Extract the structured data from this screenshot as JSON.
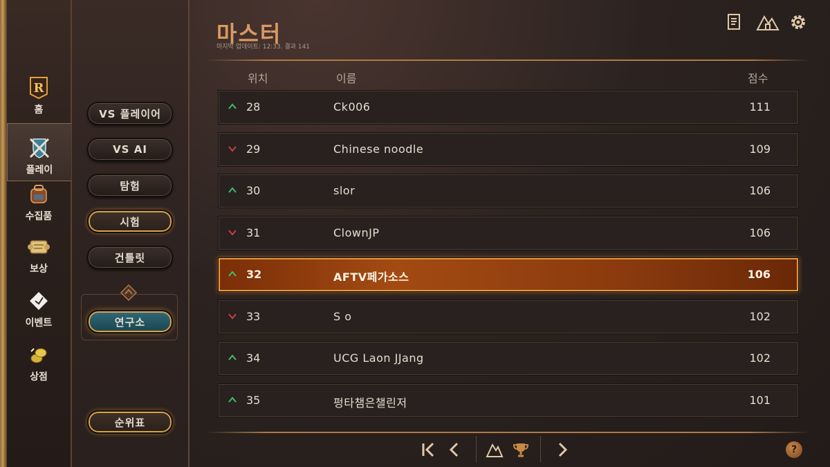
{
  "nav": {
    "items": [
      {
        "label": "홈",
        "icon": "logo-r-icon"
      },
      {
        "label": "플레이",
        "icon": "crossed-swords-shield-icon"
      },
      {
        "label": "수집품",
        "icon": "backpack-icon"
      },
      {
        "label": "보상",
        "icon": "scroll-icon"
      },
      {
        "label": "이벤트",
        "icon": "diamond-event-icon"
      },
      {
        "label": "상점",
        "icon": "coins-icon"
      }
    ]
  },
  "modes": {
    "vs_player": "VS 플레이어",
    "vs_ai": "VS AI",
    "expedition": "탐험",
    "trial": "시험",
    "gauntlet": "건틀릿",
    "lab": "연구소",
    "ladder": "순위표"
  },
  "header": {
    "title": "마스터",
    "subtitle": "마지막 업데이트: 12:33. 결과 141"
  },
  "columns": {
    "rank": "위치",
    "name": "이름",
    "score": "점수"
  },
  "rows": [
    {
      "trend": "up",
      "rank": "28",
      "name": "Ck006",
      "score": "111"
    },
    {
      "trend": "down",
      "rank": "29",
      "name": "Chinese noodle",
      "score": "109"
    },
    {
      "trend": "up",
      "rank": "30",
      "name": "slor",
      "score": "106"
    },
    {
      "trend": "down",
      "rank": "31",
      "name": "ClownJP",
      "score": "106"
    },
    {
      "trend": "up",
      "rank": "32",
      "name": "AFTV페가소스",
      "score": "106",
      "highlight": true
    },
    {
      "trend": "down",
      "rank": "33",
      "name": "S o",
      "score": "102"
    },
    {
      "trend": "up",
      "rank": "34",
      "name": "UCG Laon JJang",
      "score": "102"
    },
    {
      "trend": "up",
      "rank": "35",
      "name": "펑타챔은챌린저",
      "score": "101"
    }
  ],
  "help_label": "?",
  "colors": {
    "up": "#3fbf6a",
    "down": "#c94040",
    "accent": "#d99a62"
  }
}
